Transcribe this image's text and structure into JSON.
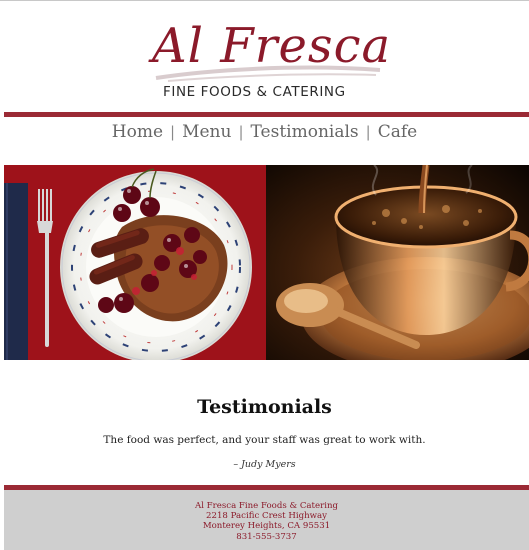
{
  "brand": {
    "name": "Al Fresca",
    "tagline": "Fine Foods & Catering",
    "accent": "#9b2a35",
    "footer_bg": "#cfcfcf"
  },
  "nav": {
    "items": [
      {
        "label": "Home"
      },
      {
        "label": "Menu"
      },
      {
        "label": "Testimonials"
      },
      {
        "label": "Cafe"
      }
    ],
    "separator": "|"
  },
  "hero": {
    "left_image": "breakfast-plate-photo",
    "right_image": "coffee-cup-photo"
  },
  "content": {
    "title": "Testimonials",
    "quote": "The food was perfect, and your staff was great to work with.",
    "author": "– Judy Myers"
  },
  "footer": {
    "company": "Al Fresca Fine Foods & Catering",
    "street": "2218 Pacific Crest Highway",
    "city": "Monterey Heights, CA 95531",
    "phone": "831-555-3737"
  }
}
